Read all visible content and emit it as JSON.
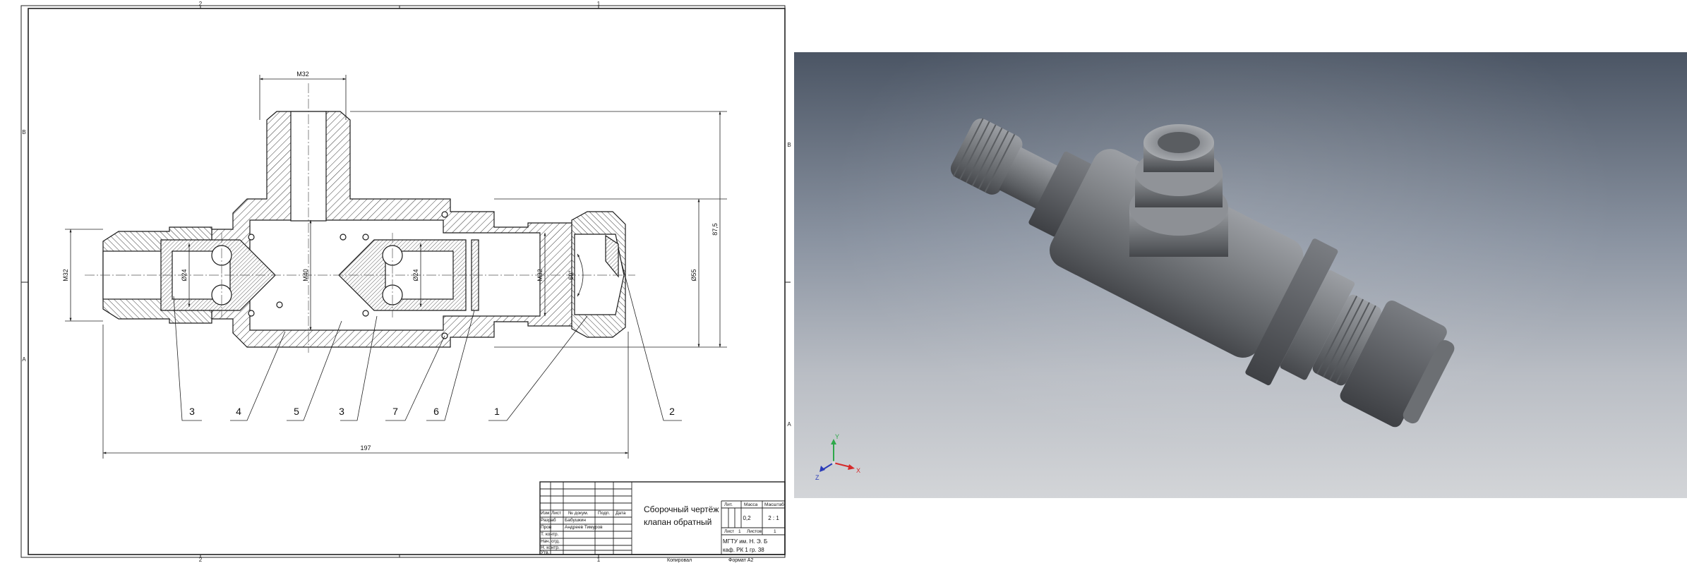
{
  "sheet": {
    "border_zones": {
      "top": [
        "2",
        "1"
      ],
      "bottom": [
        "2",
        "1"
      ],
      "left": [
        "B",
        "A"
      ],
      "right": [
        "B",
        "A"
      ]
    },
    "footer": {
      "copied": "Копировал",
      "format": "Формат A2"
    }
  },
  "dimensions": {
    "top_thread": "M32",
    "left_thread": "M32",
    "inner_thread": "M32",
    "dia_left": "Ø24",
    "dia_center": "M40",
    "dia_right": "Ø24",
    "angle": "60°",
    "dia_outer": "Ø55",
    "height": "87,5",
    "length": "197"
  },
  "callouts": [
    "3",
    "4",
    "5",
    "3",
    "7",
    "6",
    "1",
    "2"
  ],
  "title_block": {
    "title_line1": "Сборочный чертёж",
    "title_line2": "клапан обратный",
    "col_headers": [
      "Изм",
      "Лист",
      "№ докум.",
      "Подп.",
      "Дата"
    ],
    "row_labels": [
      "Разраб",
      "Пров",
      "Т. контр.",
      "Нач. отд.",
      "Н. контр.",
      "Утв."
    ],
    "developer": "Бабушкин",
    "checker": "Андреев Тимуров",
    "lit_label": "Лит.",
    "mass_label": "Масса",
    "scale_label": "Масштаб",
    "mass": "0,2",
    "scale": "2 : 1",
    "sheet_label": "Лист",
    "sheet_no": "1",
    "sheets_label": "Листов",
    "sheets_count": "1",
    "org_line1": "МГТУ им. Н. Э. Б",
    "org_line2": "каф. РК 1 гр. 38"
  },
  "viewport": {
    "axes": [
      "Y",
      "X",
      "Z"
    ],
    "axis_colors": {
      "x": "#d62a2a",
      "y": "#2ea84a",
      "z": "#2a3bb8"
    }
  }
}
